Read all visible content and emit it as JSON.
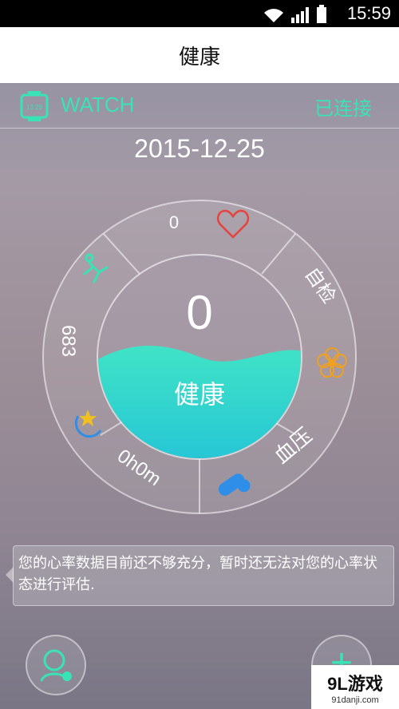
{
  "status_bar": {
    "time": "15:59"
  },
  "header": {
    "title": "健康"
  },
  "device": {
    "name": "WATCH",
    "status": "已连接",
    "watch_face_text": "13:29"
  },
  "date": "2015-12-25",
  "dial": {
    "center_value": "0",
    "center_label": "健康",
    "segments": {
      "heart_rate": "0",
      "self_check": "自检",
      "blood_pressure": "血压",
      "sleep": "0h0m",
      "steps": "683"
    }
  },
  "message": "您的心率数据目前还不够充分，暂时还无法对您的心率状态进行评估.",
  "fab": {
    "add_label": "+"
  },
  "watermark": {
    "main": "9L游戏",
    "sub": "91danji.com"
  },
  "colors": {
    "accent": "#39e3b5",
    "heart": "#e6423f",
    "pill": "#2f8ee8",
    "flower": "#f0a020"
  }
}
